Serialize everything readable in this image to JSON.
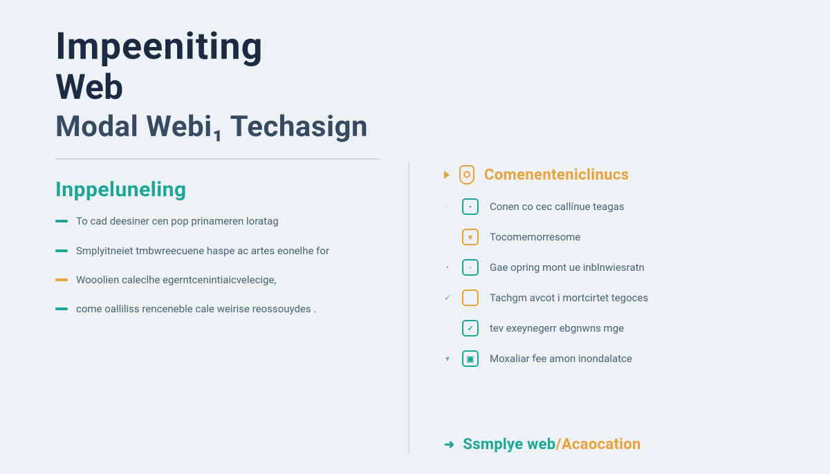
{
  "title": {
    "line1": "Impeeniting",
    "line2": "Web",
    "line3": "Modal  Webi₁  Techasign"
  },
  "left": {
    "subheading": "Inppeluneling",
    "items": [
      {
        "dash": "teal",
        "text": "To cad deesiner cen pop prinameren loratag"
      },
      {
        "dash": "teal",
        "text": "Smplyitneiet tmbwreecuene haspe ac artes eonelhe for"
      },
      {
        "dash": "orange",
        "text": "Wooolien caleclhe egerntcenintiaicvelecige,"
      },
      {
        "dash": "teal",
        "text": "come oalliliss renceneble cale weirise reossouydes ."
      }
    ]
  },
  "right": {
    "heading": "Comenenteniclinucs",
    "items": [
      {
        "glyph": "·",
        "box": "teal",
        "mark": "•",
        "text": "Conen co cec callínue teagas"
      },
      {
        "glyph": "",
        "box": "orange",
        "mark": "▾",
        "text": "Tocomemorresome"
      },
      {
        "glyph": "•",
        "box": "teal",
        "mark": "◦",
        "text": "Gae opring mont ue inblnwiesratn"
      },
      {
        "glyph": "✓",
        "box": "orange",
        "mark": "",
        "text": "Tachgm avcot i mortcirtet tegoces"
      },
      {
        "glyph": "",
        "box": "teal",
        "mark": "✓",
        "text": "tev exeynegerr ebgnwns mge"
      },
      {
        "glyph": "▾",
        "box": "teal",
        "mark": "▣",
        "text": "Moxaliar ꬵee amon inondalatce"
      }
    ],
    "footer_pre": "Ssmplye web",
    "footer_post": "Acaocation"
  }
}
